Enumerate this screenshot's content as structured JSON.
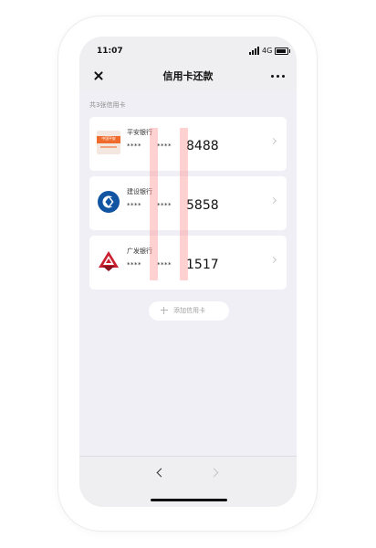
{
  "status": {
    "time": "11:07",
    "network": "4G"
  },
  "header": {
    "title": "信用卡还款"
  },
  "section": {
    "title": "共3张信用卡"
  },
  "cards": [
    {
      "bank": "平安银行",
      "masked": [
        "****",
        "****"
      ],
      "last4": "8488",
      "logo_text": "中国平安"
    },
    {
      "bank": "建设银行",
      "masked": [
        "****",
        "****"
      ],
      "last4": "5858"
    },
    {
      "bank": "广发银行",
      "masked": [
        "****",
        "****"
      ],
      "last4": "1517"
    }
  ],
  "actions": {
    "add_card": "添加信用卡"
  },
  "icons": {
    "close": "close-icon",
    "more": "more-icon",
    "chevron_right": "chevron-right-icon",
    "back": "back-icon",
    "forward": "forward-icon",
    "add": "plus-icon"
  },
  "colors": {
    "screen_bg": "#eeedf3",
    "card_bg": "#ffffff",
    "highlight": "rgba(255, 145, 145, 0.42)",
    "pingan_orange": "#ef6b2c",
    "ccb_blue": "#1155a2",
    "gdb_red": "#c91f2f"
  }
}
